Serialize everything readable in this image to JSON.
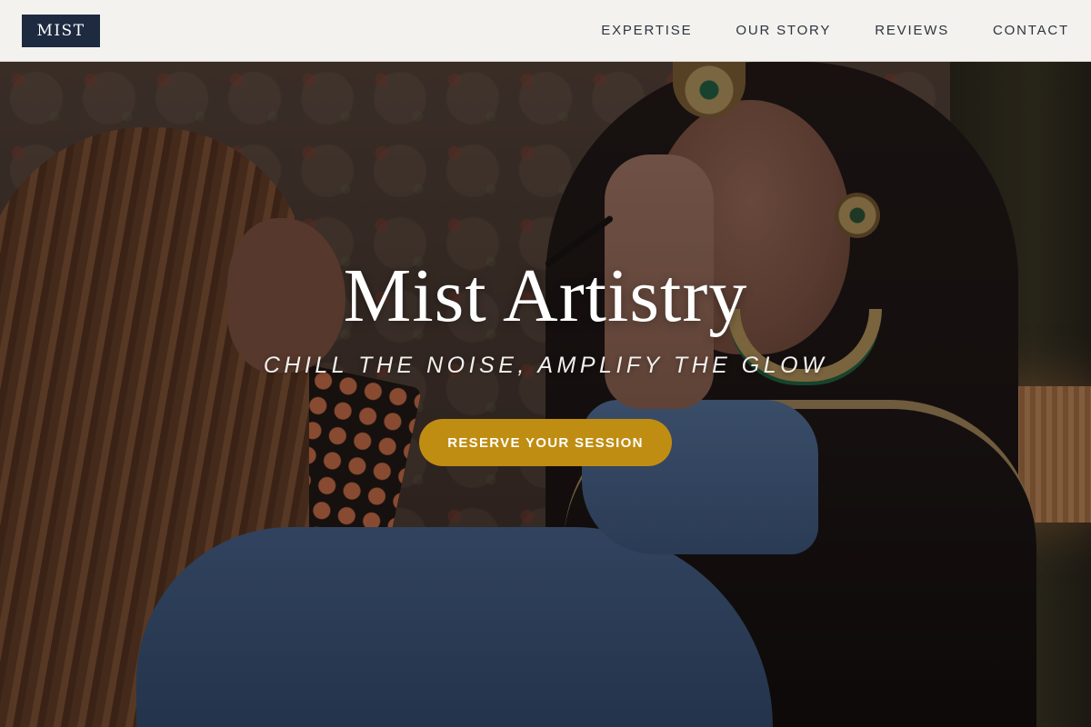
{
  "header": {
    "logo_text": "MIST",
    "nav": [
      {
        "label": "EXPERTISE"
      },
      {
        "label": "OUR STORY"
      },
      {
        "label": "REVIEWS"
      },
      {
        "label": "CONTACT"
      }
    ]
  },
  "hero": {
    "title": "Mist Artistry",
    "tagline": "CHILL THE NOISE, AMPLIFY THE GLOW",
    "cta_label": "RESERVE YOUR SESSION"
  },
  "colors": {
    "header_bg": "#f4f2ee",
    "logo_bg": "#1e2a40",
    "nav_text": "#2c3440",
    "cta_bg": "#c08d13",
    "hero_text": "#ffffff"
  }
}
